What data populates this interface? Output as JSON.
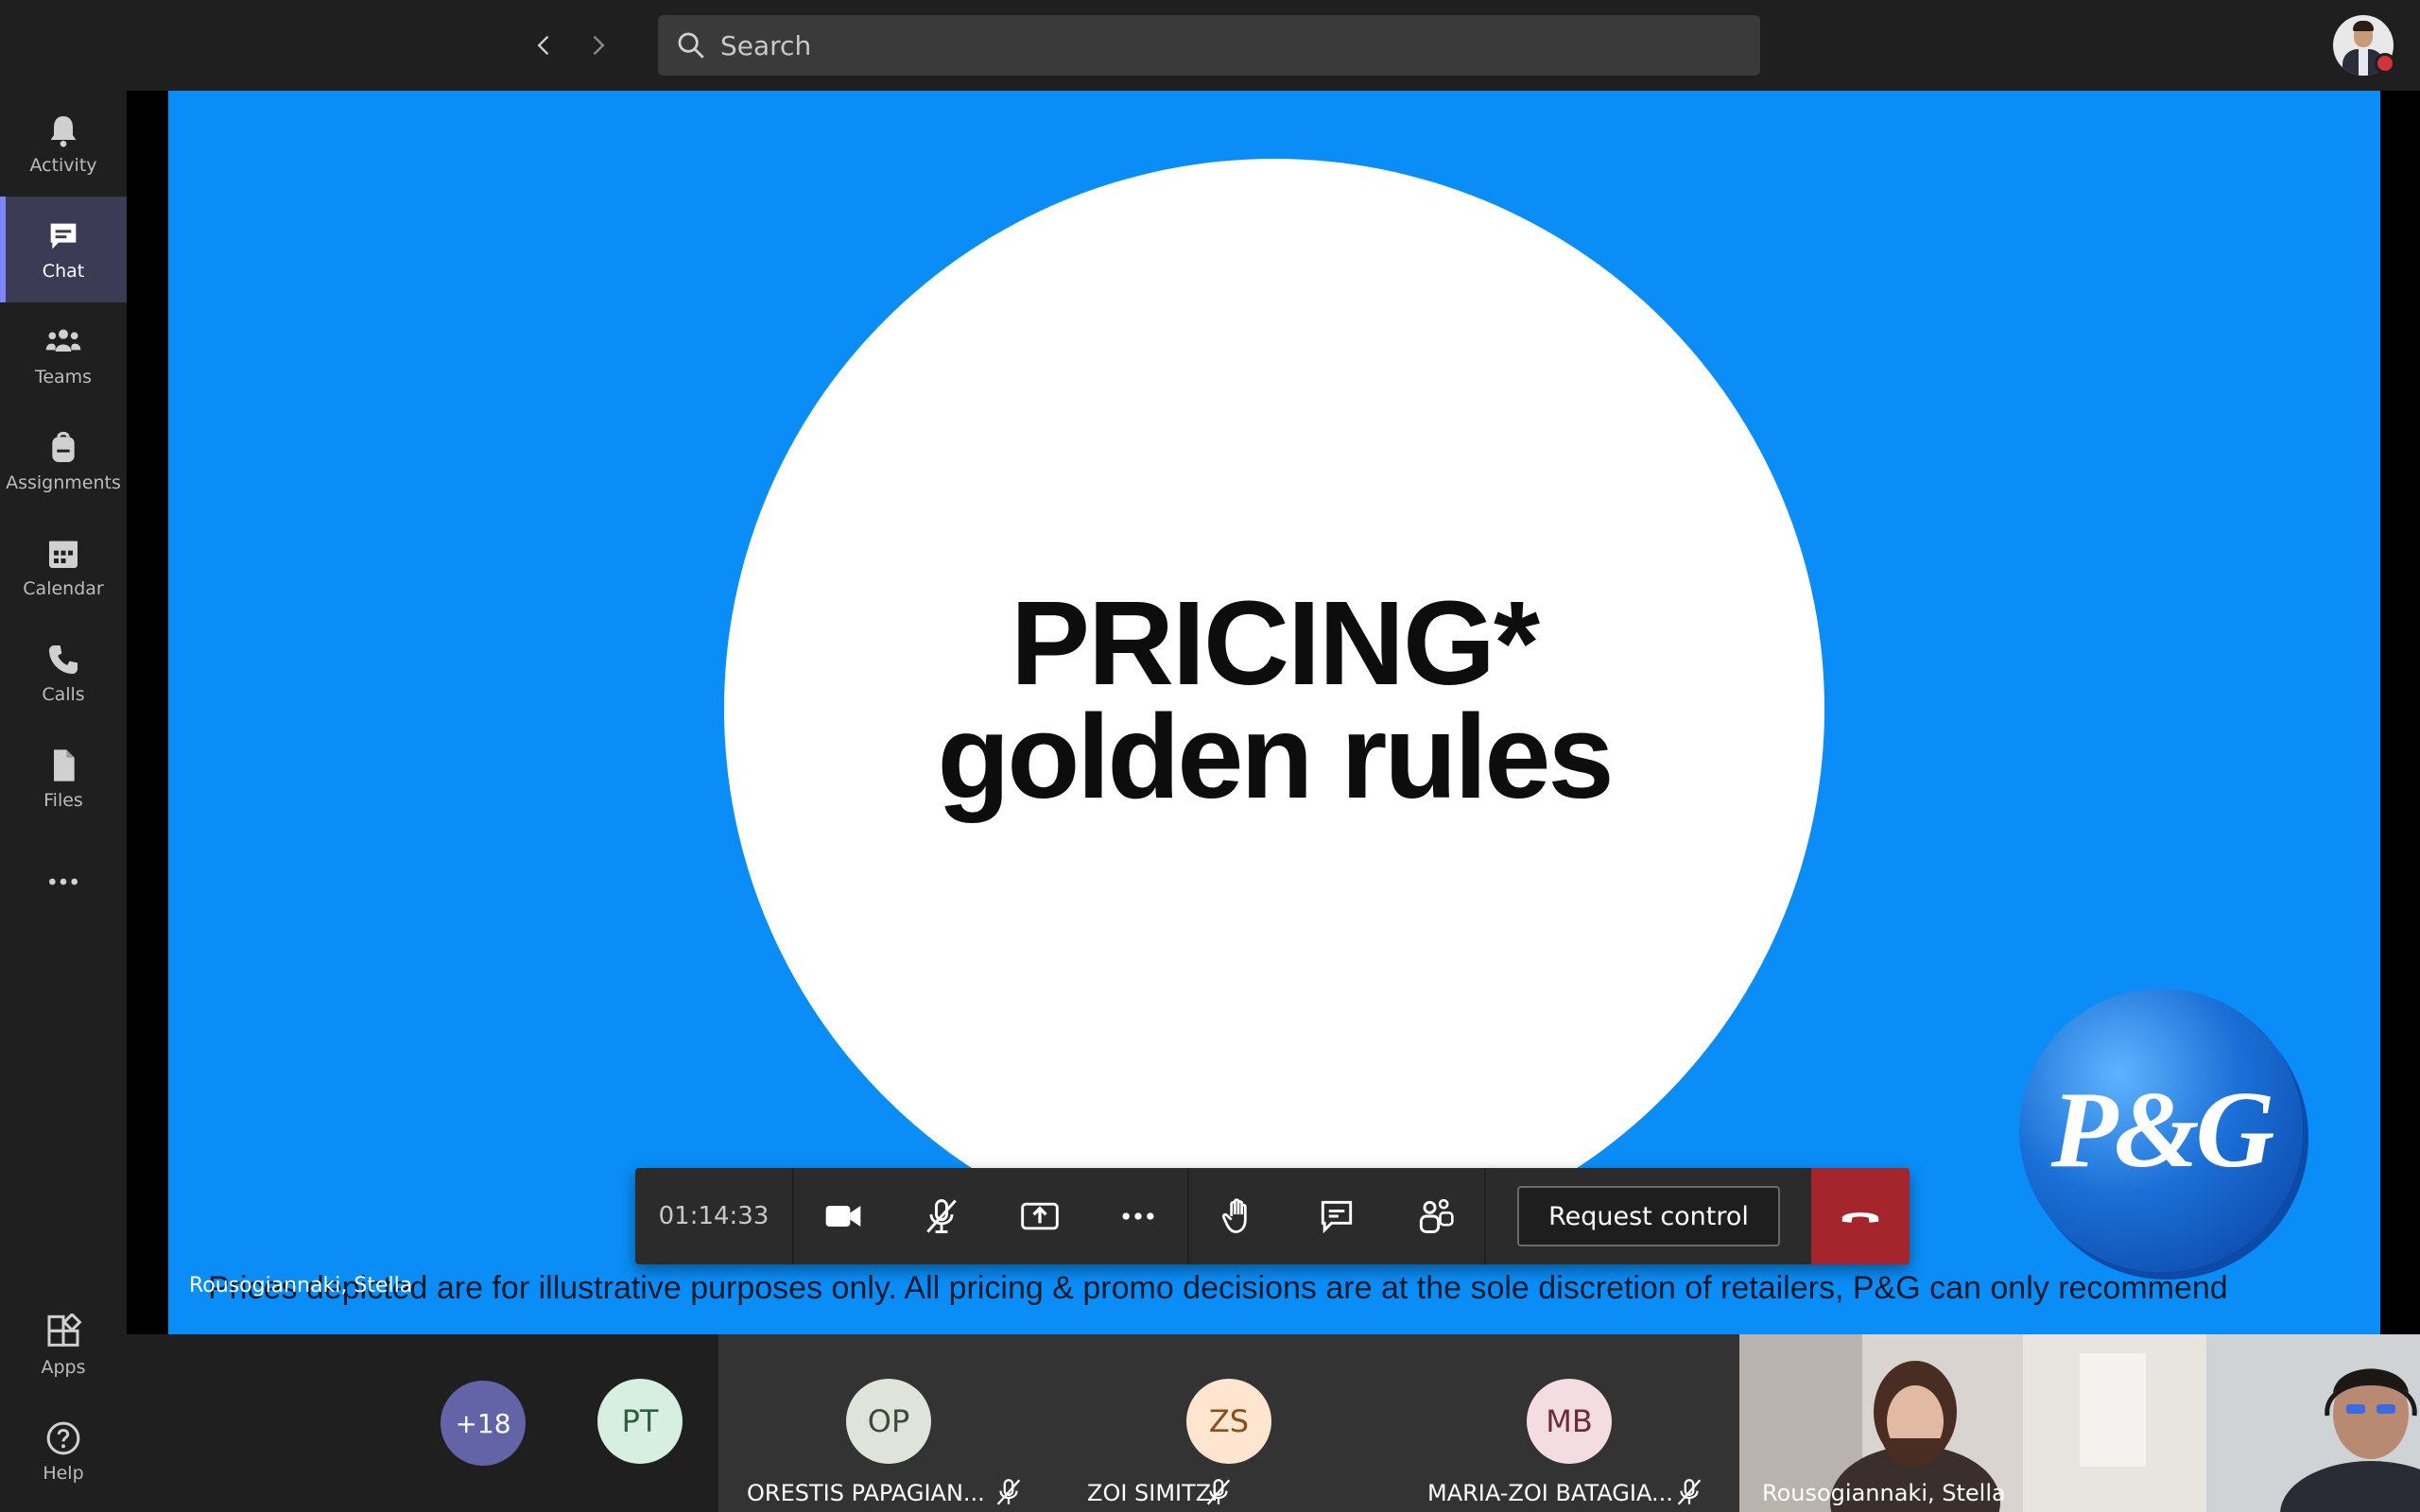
{
  "topbar": {
    "search_placeholder": "Search"
  },
  "rail": {
    "items": [
      {
        "label": "Activity"
      },
      {
        "label": "Chat"
      },
      {
        "label": "Teams"
      },
      {
        "label": "Assignments"
      },
      {
        "label": "Calendar"
      },
      {
        "label": "Calls"
      },
      {
        "label": "Files"
      }
    ],
    "apps_label": "Apps",
    "help_label": "Help"
  },
  "slide": {
    "title_line1": "PRICING*",
    "title_line2": "golden rules",
    "disclaimer": "Prices depicted are for illustrative purposes only. All pricing & promo decisions are at the sole discretion of retailers, P&G can only recommend",
    "logo_text": "P&G",
    "background_color": "#0a8df7"
  },
  "presenter": {
    "name": "Rousogiannaki, Stella"
  },
  "controls": {
    "timer": "01:14:33",
    "request_control_label": "Request control",
    "hangup_color": "#a4262c"
  },
  "participants": {
    "overflow_count": "+18",
    "tiles": [
      {
        "initials": "PT",
        "name": ""
      },
      {
        "initials": "OP",
        "name": "ORESTIS PAPAGIAN..."
      },
      {
        "initials": "ZS",
        "name": "ZOI SIMITZI"
      },
      {
        "initials": "MB",
        "name": "MARIA-ZOI BATAGIA..."
      }
    ],
    "video_tiles": [
      {
        "name": "Rousogiannaki, Stella"
      },
      {
        "name": ""
      }
    ]
  }
}
